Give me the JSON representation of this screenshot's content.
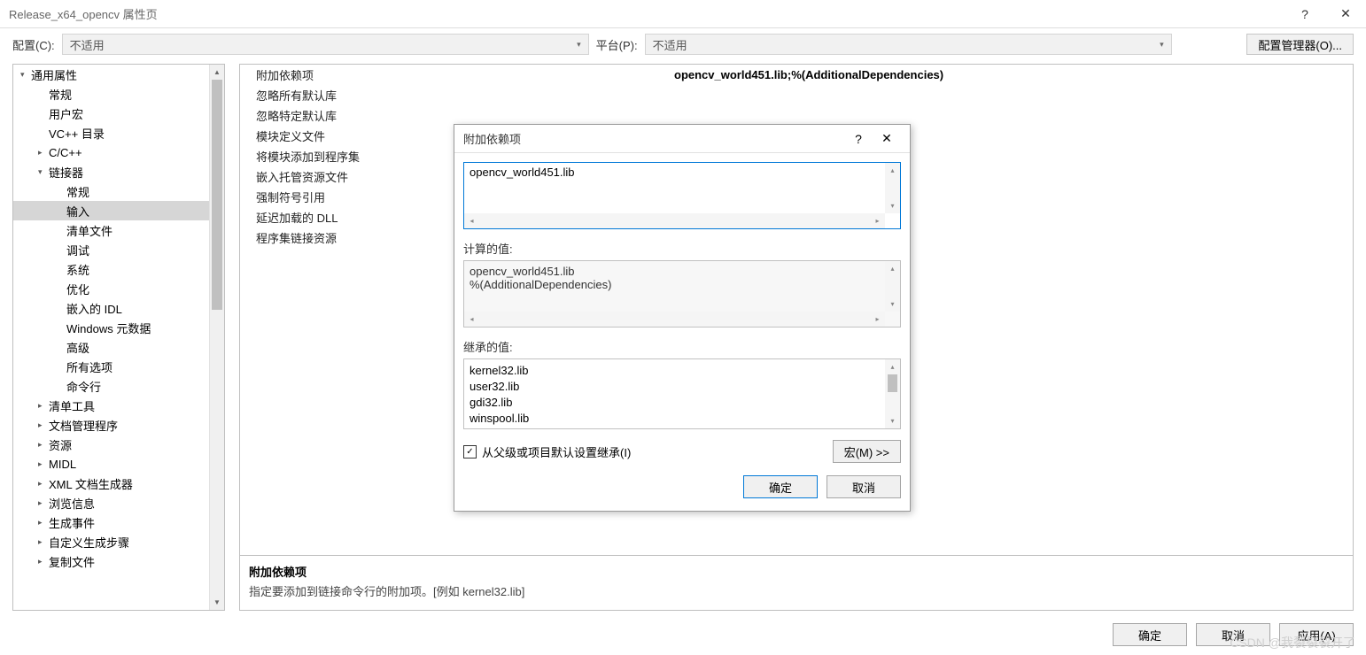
{
  "titlebar": {
    "title": "Release_x64_opencv 属性页"
  },
  "toprow": {
    "config_label": "配置(C):",
    "config_value": "不适用",
    "platform_label": "平台(P):",
    "platform_value": "不适用",
    "manager_btn": "配置管理器(O)..."
  },
  "tree": [
    {
      "l": 0,
      "exp": "▾",
      "txt": "通用属性"
    },
    {
      "l": 1,
      "exp": "",
      "txt": "常规"
    },
    {
      "l": 1,
      "exp": "",
      "txt": "用户宏"
    },
    {
      "l": 1,
      "exp": "",
      "txt": "VC++ 目录"
    },
    {
      "l": 1,
      "exp": "▸",
      "txt": "C/C++"
    },
    {
      "l": 1,
      "exp": "▾",
      "txt": "链接器"
    },
    {
      "l": 2,
      "exp": "",
      "txt": "常规"
    },
    {
      "l": 2,
      "exp": "",
      "txt": "输入",
      "sel": true
    },
    {
      "l": 2,
      "exp": "",
      "txt": "清单文件"
    },
    {
      "l": 2,
      "exp": "",
      "txt": "调试"
    },
    {
      "l": 2,
      "exp": "",
      "txt": "系统"
    },
    {
      "l": 2,
      "exp": "",
      "txt": "优化"
    },
    {
      "l": 2,
      "exp": "",
      "txt": "嵌入的 IDL"
    },
    {
      "l": 2,
      "exp": "",
      "txt": "Windows 元数据"
    },
    {
      "l": 2,
      "exp": "",
      "txt": "高级"
    },
    {
      "l": 2,
      "exp": "",
      "txt": "所有选项"
    },
    {
      "l": 2,
      "exp": "",
      "txt": "命令行"
    },
    {
      "l": 1,
      "exp": "▸",
      "txt": "清单工具"
    },
    {
      "l": 1,
      "exp": "▸",
      "txt": "文档管理程序"
    },
    {
      "l": 1,
      "exp": "▸",
      "txt": "资源"
    },
    {
      "l": 1,
      "exp": "▸",
      "txt": "MIDL"
    },
    {
      "l": 1,
      "exp": "▸",
      "txt": "XML 文档生成器"
    },
    {
      "l": 1,
      "exp": "▸",
      "txt": "浏览信息"
    },
    {
      "l": 1,
      "exp": "▸",
      "txt": "生成事件"
    },
    {
      "l": 1,
      "exp": "▸",
      "txt": "自定义生成步骤"
    },
    {
      "l": 1,
      "exp": "▸",
      "txt": "复制文件"
    }
  ],
  "props": {
    "rows": [
      {
        "name": "附加依赖项",
        "val": "opencv_world451.lib;%(AdditionalDependencies)",
        "sel": true
      },
      {
        "name": "忽略所有默认库",
        "val": ""
      },
      {
        "name": "忽略特定默认库",
        "val": ""
      },
      {
        "name": "模块定义文件",
        "val": ""
      },
      {
        "name": "将模块添加到程序集",
        "val": ""
      },
      {
        "name": "嵌入托管资源文件",
        "val": ""
      },
      {
        "name": "强制符号引用",
        "val": ""
      },
      {
        "name": "延迟加载的 DLL",
        "val": ""
      },
      {
        "name": "程序集链接资源",
        "val": ""
      }
    ],
    "desc_title": "附加依赖项",
    "desc_body": "指定要添加到链接命令行的附加项。[例如 kernel32.lib]"
  },
  "bottom": {
    "ok": "确定",
    "cancel": "取消",
    "apply": "应用(A)"
  },
  "dialog": {
    "title": "附加依赖项",
    "edit_value": "opencv_world451.lib",
    "computed_label": "计算的值:",
    "computed_value": "opencv_world451.lib\n%(AdditionalDependencies)",
    "inherited_label": "继承的值:",
    "inherited_items": [
      "kernel32.lib",
      "user32.lib",
      "gdi32.lib",
      "winspool.lib"
    ],
    "inherit_chk_label": "从父级或项目默认设置继承(I)",
    "inherit_checked": true,
    "macro_btn": "宏(M) >>",
    "ok": "确定",
    "cancel": "取消"
  },
  "watermark": "CSDN @我裂裂裂开了"
}
